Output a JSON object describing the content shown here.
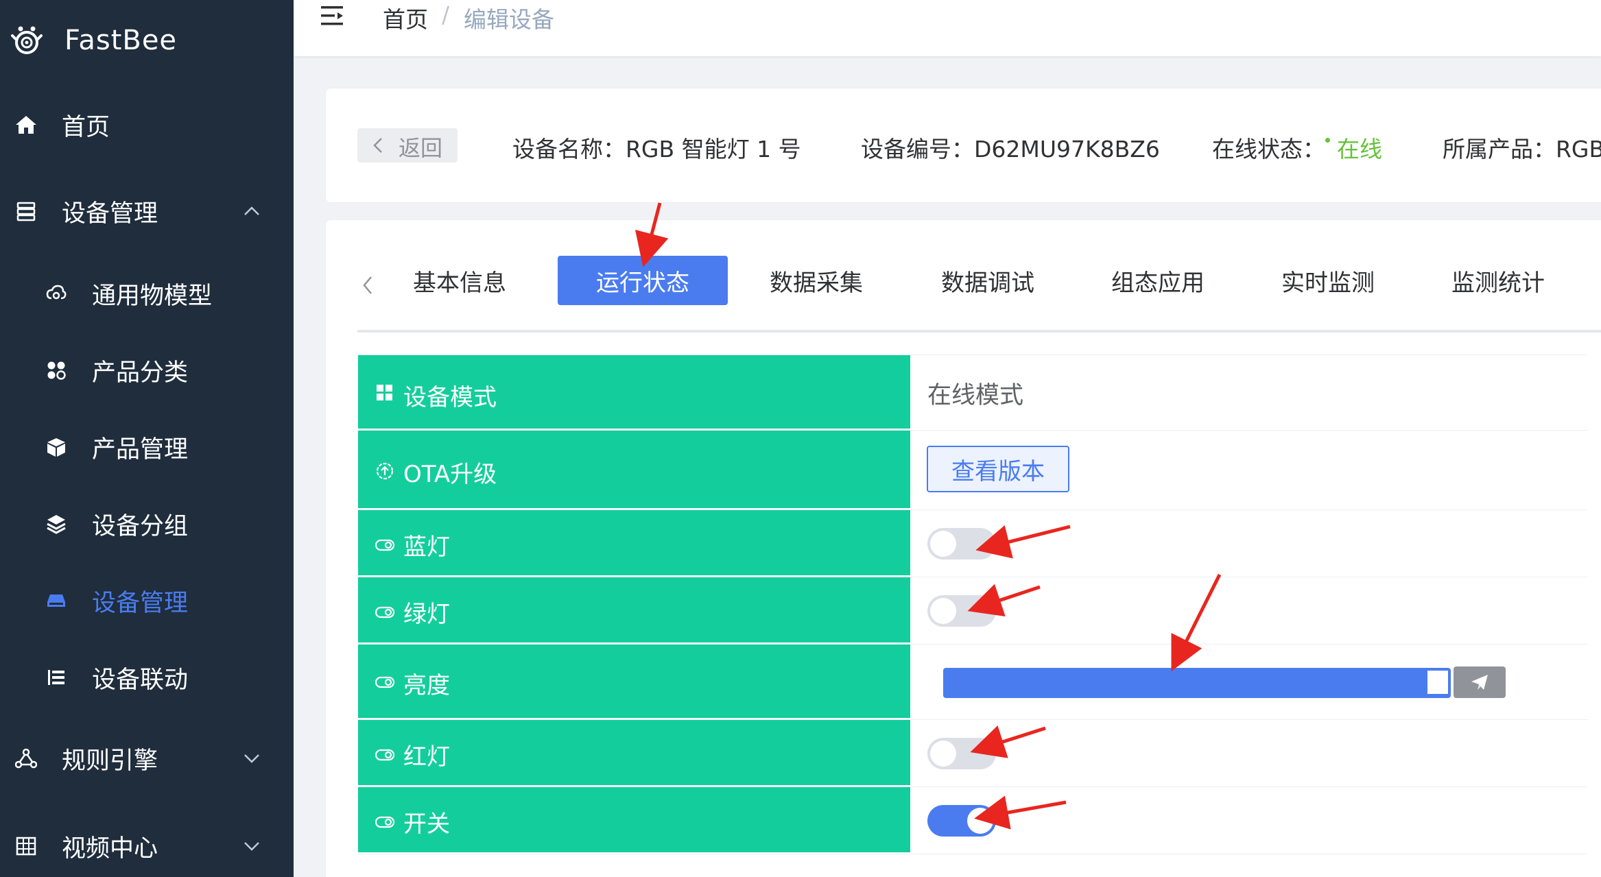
{
  "app": {
    "title": "FastBee"
  },
  "sidebar": {
    "items": [
      {
        "label": "首页",
        "icon": "home-icon"
      },
      {
        "label": "设备管理",
        "icon": "server-icon",
        "expanded": true
      },
      {
        "label": "规则引擎",
        "icon": "share-nodes-icon",
        "expanded": false
      },
      {
        "label": "视频中心",
        "icon": "grid-icon",
        "expanded": false
      }
    ],
    "sub_items": [
      {
        "label": "通用物模型",
        "icon": "cloud-icon"
      },
      {
        "label": "产品分类",
        "icon": "apps-icon"
      },
      {
        "label": "产品管理",
        "icon": "box-icon"
      },
      {
        "label": "设备分组",
        "icon": "layers-icon"
      },
      {
        "label": "设备管理",
        "icon": "device-icon",
        "active": true
      },
      {
        "label": "设备联动",
        "icon": "list-icon"
      }
    ]
  },
  "breadcrumb": {
    "home": "首页",
    "separator": "/",
    "current": "编辑设备"
  },
  "device_info": {
    "back_label": "返回",
    "name_label": "设备名称：",
    "name_value": "RGB 智能灯 1 号",
    "serial_label": "设备编号：",
    "serial_value": "D62MU97K8BZ6",
    "status_label": "在线状态：",
    "status_value": "在线",
    "product_label": "所属产品：",
    "product_value": "RGB"
  },
  "tabs": [
    "基本信息",
    "运行状态",
    "数据采集",
    "数据调试",
    "组态应用",
    "实时监测",
    "监测统计"
  ],
  "active_tab": "运行状态",
  "status_table": {
    "mode_label": "设备模式",
    "mode_value": "在线模式",
    "ota_label": "OTA升级",
    "ota_button": "查看版本",
    "blue_label": "蓝灯",
    "blue_on": false,
    "green_label": "绿灯",
    "green_on": false,
    "brightness_label": "亮度",
    "brightness_fraction": 1.0,
    "red_label": "红灯",
    "red_on": false,
    "switch_label": "开关",
    "switch_on": true
  },
  "colors": {
    "sidebar_bg": "#1f2d3d",
    "accent": "#4a7cf0",
    "label_bg": "#13ce9c",
    "online": "#67c23a",
    "annotation_arrow": "#e8261f"
  }
}
